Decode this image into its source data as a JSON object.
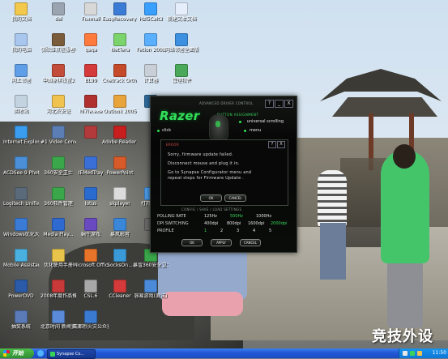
{
  "desktop": {
    "icons": [
      {
        "id": "i1",
        "label": "我的文档",
        "name": "my-documents-icon",
        "color": "#f2c94c"
      },
      {
        "id": "i2",
        "label": "del",
        "name": "batch-file-icon",
        "color": "#9aa4b0"
      },
      {
        "id": "i3",
        "label": "Foxmail",
        "name": "foxmail-icon",
        "color": "#d8d8d8"
      },
      {
        "id": "i4",
        "label": "EasyRecovery Professio...",
        "name": "easyrecovery-icon",
        "color": "#3a7bd5"
      },
      {
        "id": "i5",
        "label": "Hzl5Calt3",
        "name": "windows-app-icon",
        "color": "#3aa0ff"
      },
      {
        "id": "i6",
        "label": "新建文本文档",
        "name": "text-document-icon",
        "color": "#e6eefc"
      },
      {
        "id": "i7",
        "label": "我的电脑",
        "name": "my-computer-icon",
        "color": "#a9c6ee"
      },
      {
        "id": "i8",
        "label": "骑砍维京征服者中文版",
        "name": "game-icon",
        "color": "#7a5c3a"
      },
      {
        "id": "i9",
        "label": "gaga",
        "name": "gaga-icon",
        "color": "#ff7a3d"
      },
      {
        "id": "i10",
        "label": "NetTera",
        "name": "nettera-icon",
        "color": "#7ad36b"
      },
      {
        "id": "i11",
        "label": "Fetion 2008",
        "name": "fetion-icon",
        "color": "#5ab0ff"
      },
      {
        "id": "i12",
        "label": "网络邻居全面版",
        "name": "network-icon",
        "color": "#3d8fe0"
      },
      {
        "id": "i13",
        "label": "网上邻居",
        "name": "network-places-icon",
        "color": "#5f9fe8"
      },
      {
        "id": "i14",
        "label": "中国象棋设置2",
        "name": "chess-icon",
        "color": "#c24b3a"
      },
      {
        "id": "i15",
        "label": "BL99",
        "name": "bl99-icon",
        "color": "#d43a3a"
      },
      {
        "id": "i16",
        "label": "Cnetrack Orth...",
        "name": "cnetrack-icon",
        "color": "#c44a2a"
      },
      {
        "id": "i17",
        "label": "计算器",
        "name": "calculator-icon",
        "color": "#c9cfd6"
      },
      {
        "id": "i18",
        "label": "管理软件",
        "name": "manager-icon",
        "color": "#4aa85a"
      },
      {
        "id": "i19",
        "label": "回收站",
        "name": "recycle-bin-icon",
        "color": "#c4d3e0"
      },
      {
        "id": "i20",
        "label": "河北农安证",
        "name": "folder-icon",
        "color": "#f0c350"
      },
      {
        "id": "i21",
        "label": "hl7lw.exe",
        "name": "exe-icon",
        "color": "#b03030"
      },
      {
        "id": "i22",
        "label": "Outlook 2005",
        "name": "outlook-icon",
        "color": "#e8a33a"
      },
      {
        "id": "i23",
        "label": "",
        "name": "app-icon",
        "color": "#2f6c9e"
      },
      {
        "id": "i24",
        "label": "Internet Explorer",
        "name": "internet-explorer-icon",
        "color": "#3a9df0"
      },
      {
        "id": "i25",
        "label": "#1 Video Converter",
        "name": "video-converter-icon",
        "color": "#5b7fb5"
      },
      {
        "id": "i26",
        "label": "",
        "name": "media-icon",
        "color": "#b33a3a"
      },
      {
        "id": "i27",
        "label": "Adobe Reader 8",
        "name": "adobe-reader-icon",
        "color": "#c81e1e"
      },
      {
        "id": "i28",
        "label": "ACDSee 9 Photo...",
        "name": "acdsee-icon",
        "color": "#4b8fd8"
      },
      {
        "id": "i29",
        "label": "360安全卫士",
        "name": "360-safe-icon",
        "color": "#3aa84a"
      },
      {
        "id": "i30",
        "label": "IEMedTray",
        "name": "iemedtray-icon",
        "color": "#3a6fd8"
      },
      {
        "id": "i31",
        "label": "PowerPoint",
        "name": "powerpoint-icon",
        "color": "#d65a2a"
      },
      {
        "id": "i32",
        "label": "Logitech Unified",
        "name": "logitech-icon",
        "color": "#5a6a7a"
      },
      {
        "id": "i33",
        "label": "360软件管理",
        "name": "360-software-icon",
        "color": "#3aa84a"
      },
      {
        "id": "i34",
        "label": "lotus",
        "name": "lotus-icon",
        "color": "#2a6bd0"
      },
      {
        "id": "i35",
        "label": "skplayer",
        "name": "skplayer-icon",
        "color": "#dcdcdc"
      },
      {
        "id": "i36",
        "label": "打开网站",
        "name": "web-icon",
        "color": "#4a9ae8"
      },
      {
        "id": "i37",
        "label": "Windows优化大师",
        "name": "optimizer-icon",
        "color": "#3a7bd5"
      },
      {
        "id": "i38",
        "label": "Media Play...",
        "name": "media-player-icon",
        "color": "#2f6ad0"
      },
      {
        "id": "i39",
        "label": "蜗牛游戏",
        "name": "snail-game-icon",
        "color": "#6a4ac0"
      },
      {
        "id": "i40",
        "label": "暴风影音",
        "name": "storm-player-icon",
        "color": "#3a86d8"
      },
      {
        "id": "i41",
        "label": "",
        "name": "disk-icon",
        "color": "#6a6a6a"
      },
      {
        "id": "i42",
        "label": "Mobile Assistant",
        "name": "mobile-assistant-icon",
        "color": "#4ab0e0"
      },
      {
        "id": "i43",
        "label": "优化使用手册",
        "name": "manual-icon",
        "color": "#e8c44a"
      },
      {
        "id": "i44",
        "label": "Microsoft Office ...",
        "name": "office-icon",
        "color": "#e8742a"
      },
      {
        "id": "i45",
        "label": "SocksOn...",
        "name": "socks-icon",
        "color": "#3a9ad8"
      },
      {
        "id": "i46",
        "label": "暴雪360安全卫士",
        "name": "security-icon",
        "color": "#3aa84a"
      },
      {
        "id": "i47",
        "label": "PowerDVD",
        "name": "powerdvd-icon",
        "color": "#2a5aa8"
      },
      {
        "id": "i48",
        "label": "2008年度作品推荐",
        "name": "recommend-icon",
        "color": "#c83a3a"
      },
      {
        "id": "i49",
        "label": "CSL.6",
        "name": "csl-icon",
        "color": "#a8a8a8"
      },
      {
        "id": "i50",
        "label": "CCleaner",
        "name": "ccleaner-icon",
        "color": "#d43a3a"
      },
      {
        "id": "i51",
        "label": "容易游戏(测试)",
        "name": "game-test-icon",
        "color": "#4a8ad8"
      },
      {
        "id": "i52",
        "label": "抽奖系统",
        "name": "lottery-icon",
        "color": "#5a7ab8"
      },
      {
        "id": "i53",
        "label": "北京时间 新闻资讯",
        "name": "news-icon",
        "color": "#5a8ad8"
      },
      {
        "id": "i54",
        "label": "成都烈火灾公众查询",
        "name": "query-icon",
        "color": "#3a7ad0"
      }
    ]
  },
  "razer": {
    "title": "ADVANCED DRIVER CONTROL",
    "logo": "Razer",
    "assignment_label": "BUTTON ASSIGNMENT",
    "row1_value": "universal scrolling",
    "row2_left": "click",
    "row2_right": "menu",
    "driver_line": "CONFIG / SAVE / LOAD SETTINGS",
    "stats": [
      {
        "key": "POLLING RATE",
        "v1": "125Hz",
        "v2": "500Hz",
        "v3": "1000Hz"
      },
      {
        "key": "DPI SWITCHING",
        "v1": "400dpi",
        "v2": "800dpi",
        "v3": "1600dpi",
        "v4": "2000dpi"
      },
      {
        "key": "PROFILE",
        "v1": "1",
        "v2": "2",
        "v3": "3",
        "v4": "4",
        "v5": "5"
      }
    ],
    "buttons": {
      "ok": "OK",
      "apply": "APPLY",
      "cancel": "CANCEL"
    },
    "controls": {
      "help": "?",
      "minimize": "_",
      "close": "X"
    }
  },
  "dialog": {
    "title": "ERROR",
    "lines": [
      "Sorry, firmware update failed.",
      "Disconnect mouse and plug it in.",
      "Go to Synapse Configurator menu and",
      "repeat steps for Firmware Update ."
    ],
    "ok": "OK",
    "cancel": "CANCEL",
    "help": "?",
    "close": "X"
  },
  "taskbar": {
    "start": "开始",
    "task_label": "Synapse Co...",
    "clock": "11:50"
  },
  "watermark": "竞技外设",
  "colors": {
    "razer_green": "#39d35a",
    "taskbar_blue": "#2459d8",
    "start_green": "#3aa83a"
  }
}
